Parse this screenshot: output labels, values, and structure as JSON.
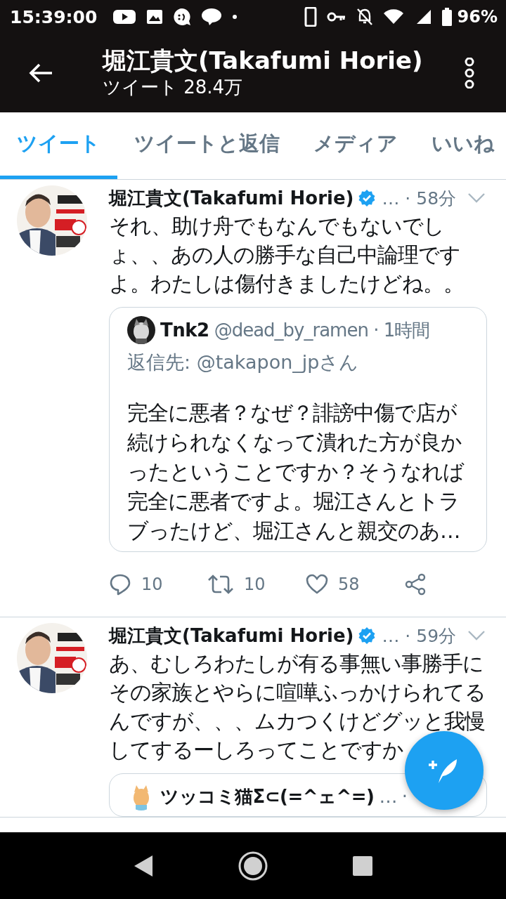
{
  "status_bar": {
    "time": "15:39:00",
    "battery": "96%"
  },
  "header": {
    "title": "堀江貴文(Takafumi Horie)",
    "subtitle": "ツイート 28.4万"
  },
  "tabs": [
    {
      "label": "ツイート",
      "selected": true
    },
    {
      "label": "ツイートと返信",
      "selected": false
    },
    {
      "label": "メディア",
      "selected": false
    },
    {
      "label": "いいね",
      "selected": false
    }
  ],
  "tweets": [
    {
      "name": "堀江貴文(Takafumi Horie)",
      "verified": true,
      "meta": "… · 58分",
      "text": "それ、助け舟でもなんでもないでしょ、、あの人の勝手な自己中論理ですよ。わたしは傷付きましたけどね。。",
      "quote": {
        "name": "Tnk2",
        "handle": "@dead_by_ramen · 1時間",
        "reply_to": "返信先: @takapon_jpさん",
        "text": "完全に悪者？なぜ？誹謗中傷で店が続けられなくなって潰れた方が良かったということですか？そうなれば完全に悪者ですよ。堀江さんとトラブったけど、堀江さんと親交のあ…"
      },
      "actions": {
        "replies": "10",
        "retweets": "10",
        "likes": "58"
      }
    },
    {
      "name": "堀江貴文(Takafumi Horie)",
      "verified": true,
      "meta": "… · 59分",
      "text": "あ、むしろわたしが有る事無い事勝手にその家族とやらに喧嘩ふっかけられてるんですが、、、ムカつくけどグッと我慢してするーしろってことですか",
      "quote": {
        "name": "ツッコミ猫Σ⊂(=^ェ^=)",
        "handle": "… ·"
      }
    }
  ]
}
